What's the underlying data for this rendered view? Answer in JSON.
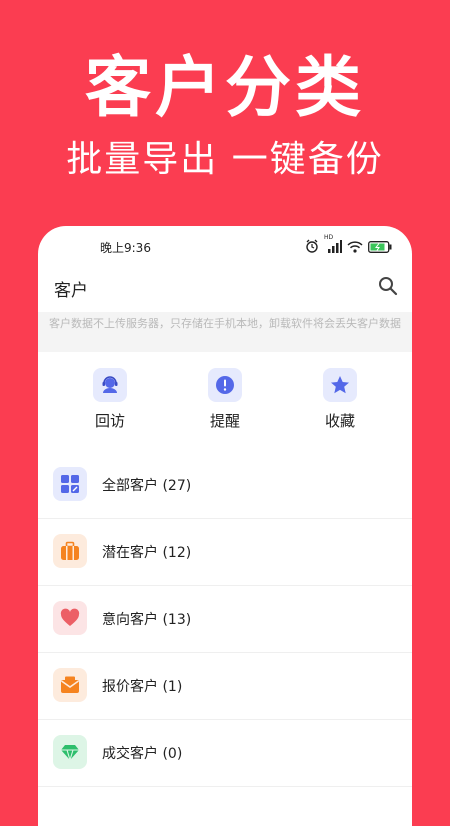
{
  "promo": {
    "title": "客户分类",
    "subtitle": "批量导出  一键备份"
  },
  "status_bar": {
    "time": "晚上9:36",
    "network_label": "HD"
  },
  "app_bar": {
    "title": "客户",
    "search_icon": "search-icon"
  },
  "notice": {
    "text": "客户数据不上传服务器，只存储在手机本地，卸载软件将会丢失客户数据"
  },
  "quick_actions": [
    {
      "label": "回访",
      "icon": "headset-icon",
      "color": "#5468E8"
    },
    {
      "label": "提醒",
      "icon": "alert-icon",
      "color": "#5468E8"
    },
    {
      "label": "收藏",
      "icon": "star-icon",
      "color": "#5468E8"
    }
  ],
  "categories": [
    {
      "label": "全部客户 (27)",
      "icon": "grid-icon",
      "color": "#5468E8",
      "bg": "#E6EAFD"
    },
    {
      "label": "潜在客户 (12)",
      "icon": "briefcase-icon",
      "color": "#F5831F",
      "bg": "#FDEBDD"
    },
    {
      "label": "意向客户 (13)",
      "icon": "heart-icon",
      "color": "#EC5F66",
      "bg": "#FCE4E5"
    },
    {
      "label": "报价客户 (1)",
      "icon": "mail-icon",
      "color": "#F5831F",
      "bg": "#FDEBDD"
    },
    {
      "label": "成交客户 (0)",
      "icon": "diamond-icon",
      "color": "#2DBE6C",
      "bg": "#DDF5E6"
    }
  ]
}
